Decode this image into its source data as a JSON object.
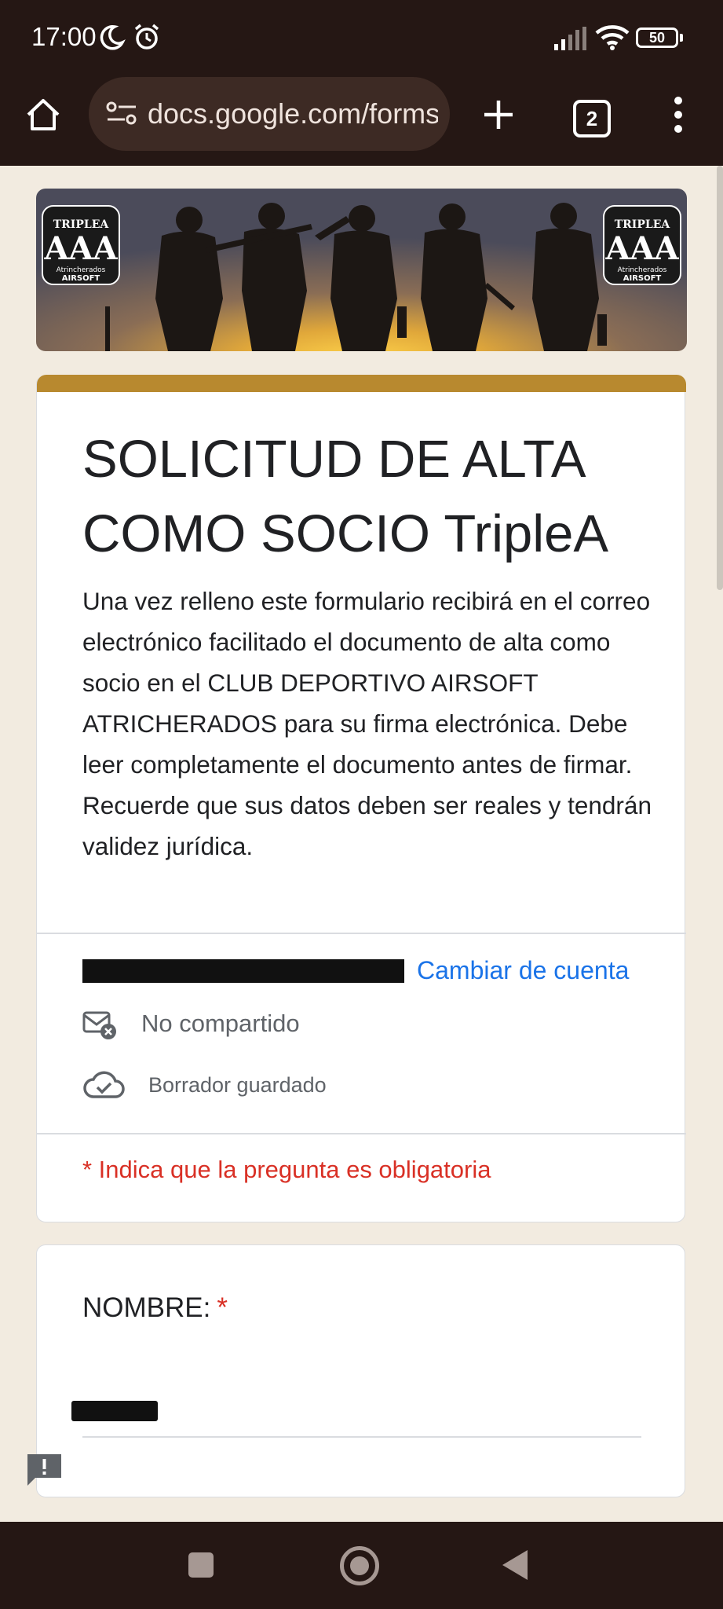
{
  "status_bar": {
    "time": "17:00",
    "battery": "50"
  },
  "browser": {
    "url": "docs.google.com/forms",
    "tab_count": "2"
  },
  "form": {
    "title": "SOLICITUD DE ALTA COMO SOCIO TripleA",
    "description": "Una vez relleno este formulario recibirá en el correo electrónico facilitado el documento de alta como socio en el CLUB DEPORTIVO AIRSOFT ATRICHERADOS para su firma electrónica. Debe leer completamente el documento antes de firmar. Recuerde que sus datos deben ser reales y tendrán validez jurídica.",
    "account": {
      "switch_label": "Cambiar de cuenta",
      "not_shared_label": "No compartido",
      "draft_label": "Borrador guardado"
    },
    "required_note": "* Indica que la pregunta es obligatoria",
    "questions": [
      {
        "label": "NOMBRE:",
        "required_mark": "*"
      }
    ]
  },
  "header_logo": {
    "main_text": "AAA",
    "arc_text": "TRIPLEA",
    "sub1": "Atrincherados",
    "sub2": "AIRSOFT"
  },
  "colors": {
    "system_bar": "#251714",
    "page_background": "#f2ebe0",
    "form_accent": "#b8892f",
    "link": "#1a73e8",
    "required": "#d93025"
  }
}
